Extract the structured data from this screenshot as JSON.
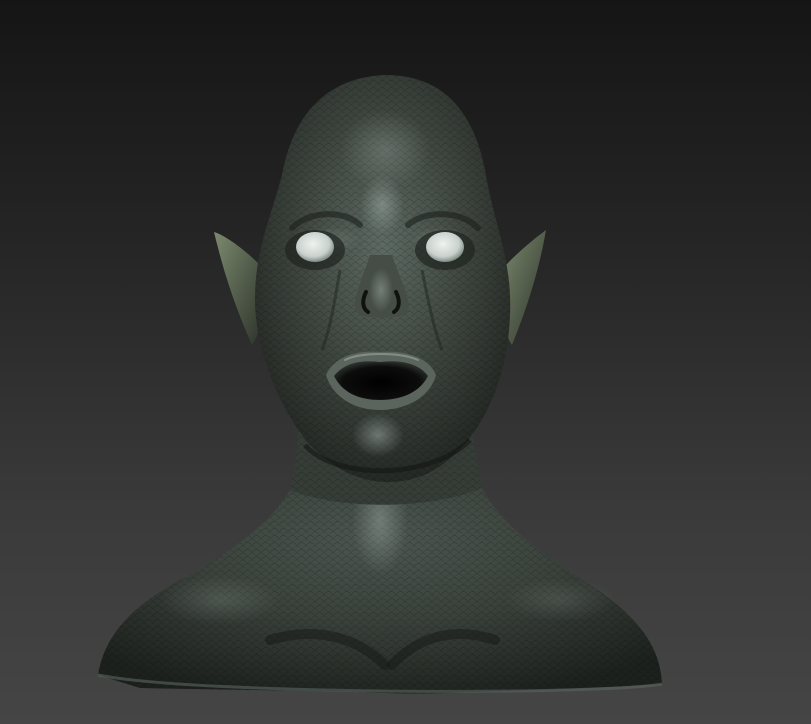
{
  "scene": {
    "background_top": "#151515",
    "background_bottom": "#454545",
    "subject": "sculpt-bust",
    "skin_base": "#3f463f",
    "skin_highlight": "#8e9e98",
    "skin_shadow": "#1b1f1b",
    "eye_color": "#d4dcd8",
    "mouth_interior": "#0a0b0a"
  }
}
